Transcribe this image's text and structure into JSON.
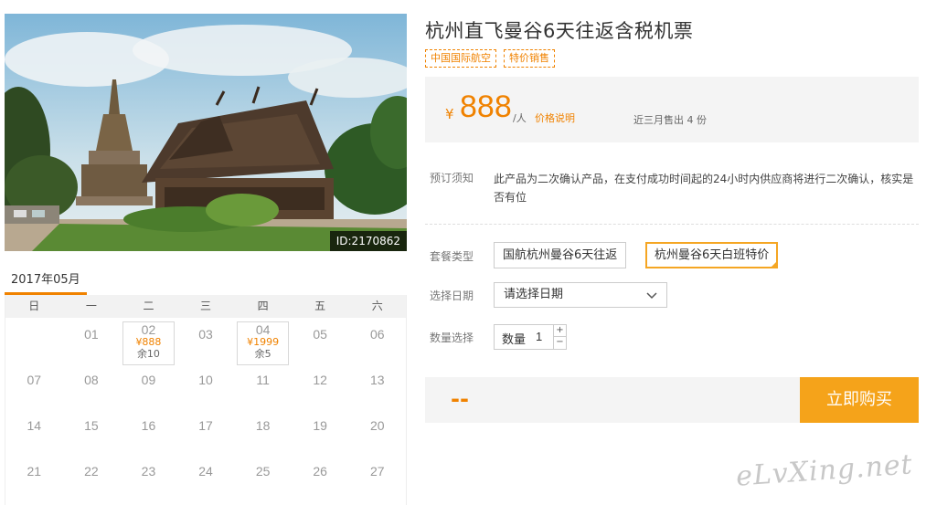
{
  "photo": {
    "id_label": "ID:2170862"
  },
  "calendar": {
    "month_label": "2017年05月",
    "weekdays": [
      "日",
      "一",
      "二",
      "三",
      "四",
      "五",
      "六"
    ],
    "weeks": [
      [
        {
          "day": ""
        },
        {
          "day": "01"
        },
        {
          "day": "02",
          "price": "¥888",
          "remain": "余10"
        },
        {
          "day": "03"
        },
        {
          "day": "04",
          "price": "¥1999",
          "remain": "余5"
        },
        {
          "day": "05"
        },
        {
          "day": "06"
        }
      ],
      [
        {
          "day": "07"
        },
        {
          "day": "08"
        },
        {
          "day": "09"
        },
        {
          "day": "10"
        },
        {
          "day": "11"
        },
        {
          "day": "12"
        },
        {
          "day": "13"
        }
      ],
      [
        {
          "day": "14"
        },
        {
          "day": "15"
        },
        {
          "day": "16"
        },
        {
          "day": "17"
        },
        {
          "day": "18"
        },
        {
          "day": "19"
        },
        {
          "day": "20"
        }
      ],
      [
        {
          "day": "21"
        },
        {
          "day": "22"
        },
        {
          "day": "23"
        },
        {
          "day": "24"
        },
        {
          "day": "25"
        },
        {
          "day": "26"
        },
        {
          "day": "27"
        }
      ]
    ]
  },
  "product": {
    "title": "杭州直飞曼谷6天往返含税机票",
    "tags": [
      "中国国际航空",
      "特价销售"
    ],
    "price": {
      "currency": "¥",
      "value": "888",
      "unit": "/人",
      "explain_link": "价格说明",
      "sold_text": "近三月售出 4 份"
    },
    "notice": {
      "label": "预订须知",
      "text": "此产品为二次确认产品，在支付成功时间起的24小时内供应商将进行二次确认，核实是否有位"
    },
    "package": {
      "label": "套餐类型",
      "options": [
        "国航杭州曼谷6天往返",
        "杭州曼谷6天白班特价"
      ],
      "selected_index": 1
    },
    "date": {
      "label": "选择日期",
      "placeholder": "请选择日期"
    },
    "quantity": {
      "label": "数量选择",
      "field_label": "数量",
      "value": "1",
      "plus": "+",
      "minus": "−"
    }
  },
  "purchase": {
    "total": "--",
    "buy_label": "立即购买"
  },
  "watermark": "eLvXing.net",
  "colors": {
    "accent": "#f08200",
    "button": "#f5a31a",
    "selected_border": "#f5a623"
  }
}
